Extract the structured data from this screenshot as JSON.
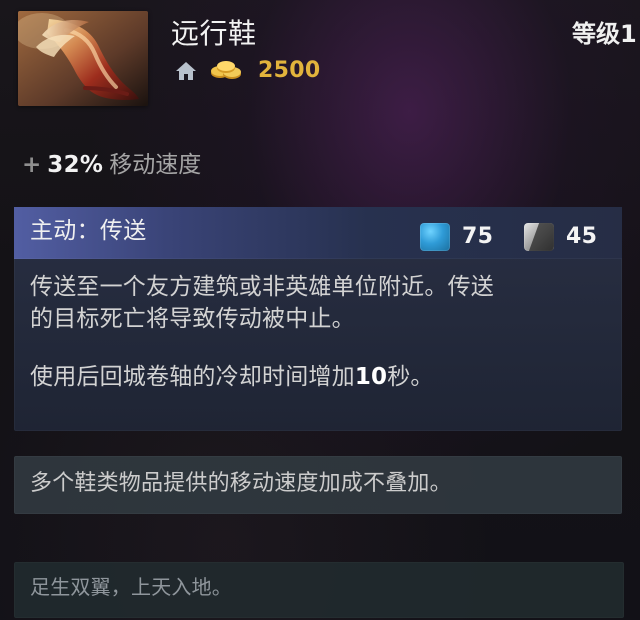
{
  "header": {
    "item_name": "远行鞋",
    "gold_cost": "2500",
    "level_text": "等级1"
  },
  "stats": {
    "speed_prefix": "+",
    "speed_value": "32%",
    "speed_label": "移动速度"
  },
  "active": {
    "title": "主动：传送",
    "mana_cost": "75",
    "cooldown": "45",
    "description_line_1": "传送至一个友方建筑或非英雄单位附近。传送",
    "description_line_2": "的目标死亡将导致传动被中止。",
    "description_line_3_prefix": "使用后回城卷轴的冷却时间增加",
    "description_line_3_number": "10",
    "description_line_3_suffix": "秒。"
  },
  "notes": {
    "stacking_note": "多个鞋类物品提供的移动速度加成不叠加。"
  },
  "lore": {
    "text": "足生双翼，上天入地。"
  },
  "icons": {
    "item_icon": "boots-icon",
    "home_icon": "home-icon",
    "gold_icon": "gold-coins-icon",
    "mana_icon": "mana-cost-icon",
    "cooldown_icon": "cooldown-icon"
  },
  "colors": {
    "gold": "#e2b43c",
    "active_header": "#525ea3",
    "mana": "#2f9bd7"
  }
}
